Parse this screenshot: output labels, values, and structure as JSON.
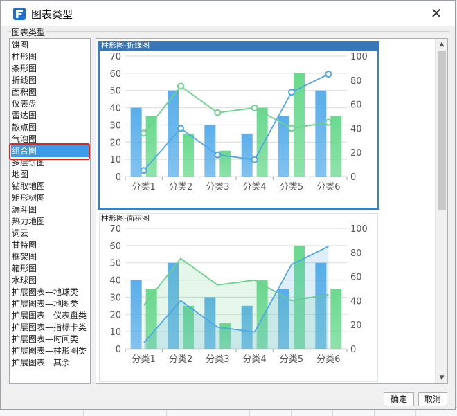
{
  "dialog": {
    "title": "图表类型",
    "group_label": "图表类型",
    "buttons": {
      "ok": "确定",
      "cancel": "取消"
    }
  },
  "chart_types": [
    "饼图",
    "柱形图",
    "条形图",
    "折线图",
    "面积图",
    "仪表盘",
    "雷达图",
    "散点图",
    "气泡图",
    "组合图",
    "多层饼图",
    "地图",
    "钻取地图",
    "矩形树图",
    "漏斗图",
    "热力地图",
    "词云",
    "甘特图",
    "框架图",
    "箱形图",
    "水球图",
    "扩展图表—地球类",
    "扩展图表—地图类",
    "扩展图表—仪表盘类",
    "扩展图表—指标卡类",
    "扩展图表—时间类",
    "扩展图表—柱形图类",
    "扩展图表—其余"
  ],
  "selected_type": "组合图",
  "colors": {
    "bar_blue": "#5aaeea",
    "bar_green": "#6ad98e",
    "line_blue": "#4da6e6",
    "line_green": "#6cd18c",
    "selection": "#3e9be9",
    "highlight_ring": "#e8211b",
    "card_selected_border": "#3e7fc0"
  },
  "previews": [
    {
      "title": "柱形图-折线图",
      "variant": "line",
      "selected": true
    },
    {
      "title": "柱形图-面积图",
      "variant": "area",
      "selected": false
    }
  ],
  "chart_data": [
    {
      "type": "bar",
      "title": "柱形图-折线图",
      "categories": [
        "分类1",
        "分类2",
        "分类3",
        "分类4",
        "分类5",
        "分类6"
      ],
      "y_left": {
        "lim": [
          0,
          70
        ],
        "ticks": [
          0,
          10,
          20,
          30,
          40,
          50,
          60,
          70
        ]
      },
      "y_right": {
        "lim": [
          0,
          100
        ],
        "ticks": [
          0,
          20,
          40,
          60,
          80,
          100
        ]
      },
      "series": [
        {
          "kind": "bar",
          "axis": "left",
          "color": "#5aaeea",
          "values": [
            40,
            50,
            30,
            25,
            35,
            50
          ]
        },
        {
          "kind": "bar",
          "axis": "left",
          "color": "#6ad98e",
          "values": [
            35,
            25,
            15,
            40,
            60,
            35
          ]
        },
        {
          "kind": "line",
          "axis": "right",
          "color": "#6cd18c",
          "values": [
            36,
            75,
            53,
            57,
            40,
            45
          ]
        },
        {
          "kind": "line",
          "axis": "right",
          "color": "#4da6e6",
          "values": [
            5,
            40,
            18,
            14,
            70,
            85
          ]
        }
      ],
      "grid": true
    },
    {
      "type": "bar",
      "title": "柱形图-面积图",
      "categories": [
        "分类1",
        "分类2",
        "分类3",
        "分类4",
        "分类5",
        "分类6"
      ],
      "y_left": {
        "lim": [
          0,
          70
        ],
        "ticks": [
          0,
          10,
          20,
          30,
          40,
          50,
          60,
          70
        ]
      },
      "y_right": {
        "lim": [
          0,
          100
        ],
        "ticks": [
          0,
          20,
          40,
          60,
          80,
          100
        ]
      },
      "series": [
        {
          "kind": "bar",
          "axis": "left",
          "color": "#5aaeea",
          "values": [
            40,
            50,
            30,
            25,
            35,
            50
          ]
        },
        {
          "kind": "bar",
          "axis": "left",
          "color": "#6ad98e",
          "values": [
            35,
            25,
            15,
            40,
            60,
            35
          ]
        },
        {
          "kind": "area",
          "axis": "right",
          "color": "#6cd18c",
          "values": [
            36,
            75,
            53,
            57,
            40,
            45
          ]
        },
        {
          "kind": "area",
          "axis": "right",
          "color": "#4da6e6",
          "values": [
            5,
            40,
            18,
            14,
            70,
            85
          ]
        }
      ],
      "grid": true
    }
  ]
}
